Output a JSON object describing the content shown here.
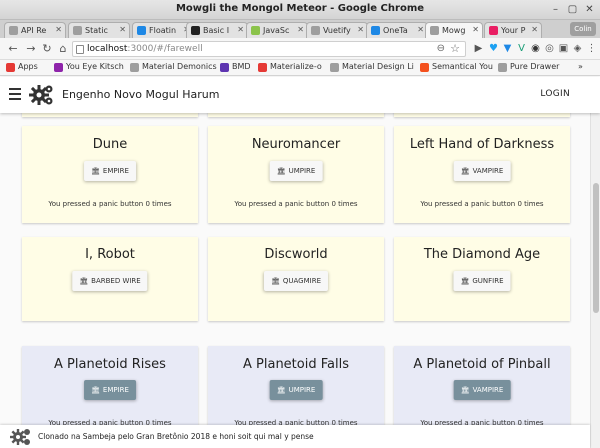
{
  "window": {
    "title": "Mowgli the Mongol Meteor - Google Chrome"
  },
  "tabs": [
    {
      "label": "API Re",
      "fav_color": "#9e9e9e"
    },
    {
      "label": "Static",
      "fav_color": "#9e9e9e"
    },
    {
      "label": "Floatin",
      "fav_color": "#1e88e5"
    },
    {
      "label": "Basic I",
      "fav_color": "#222222"
    },
    {
      "label": "JavaSc",
      "fav_color": "#8bc34a"
    },
    {
      "label": "Vuetify",
      "fav_color": "#9e9e9e"
    },
    {
      "label": "OneTa",
      "fav_color": "#1e88e5"
    },
    {
      "label": "Mowg",
      "fav_color": "#9e9e9e"
    },
    {
      "label": "Your P",
      "fav_color": "#e91e63"
    }
  ],
  "profile_label": "Colin",
  "address": {
    "host": "localhost",
    "path": ":3000/#/farewell"
  },
  "bookmarks": [
    {
      "label": "Apps",
      "color": "#e53935"
    },
    {
      "label": "You Eye Kitsch",
      "color": "#8e24aa"
    },
    {
      "label": "Material Demonics",
      "color": "#9e9e9e"
    },
    {
      "label": "BMD",
      "color": "#5e35b1"
    },
    {
      "label": "Materialize-o",
      "color": "#e53935"
    },
    {
      "label": "Material Design Li",
      "color": "#9e9e9e"
    },
    {
      "label": "Semantical You",
      "color": "#f4511e"
    },
    {
      "label": "Pure Drawer",
      "color": "#9e9e9e"
    }
  ],
  "bookmarks_more": "»",
  "app": {
    "title": "Engenho Novo Mogul Harum",
    "login": "LOGIN"
  },
  "cards": [
    {
      "title": "Dune",
      "button": "EMPIRE",
      "text": "You pressed a panic button 0 times",
      "theme": "yellow"
    },
    {
      "title": "Neuromancer",
      "button": "UMPIRE",
      "text": "You pressed a panic button 0 times",
      "theme": "yellow"
    },
    {
      "title": "Left Hand of Darkness",
      "button": "VAMPIRE",
      "text": "You pressed a panic button 0 times",
      "theme": "yellow"
    },
    {
      "title": "I, Robot",
      "button": "BARBED WIRE",
      "text": "",
      "theme": "yellow"
    },
    {
      "title": "Discworld",
      "button": "QUAGMIRE",
      "text": "",
      "theme": "yellow"
    },
    {
      "title": "The Diamond Age",
      "button": "GUNFIRE",
      "text": "",
      "theme": "yellow"
    },
    {
      "title": "A Planetoid Rises",
      "button": "EMPIRE",
      "text": "You pressed a panic button 0 times",
      "theme": "blue"
    },
    {
      "title": "A Planetoid Falls",
      "button": "UMPIRE",
      "text": "You pressed a panic button 0 times",
      "theme": "blue"
    },
    {
      "title": "A Planetoid of Pinball",
      "button": "VAMPIRE",
      "text": "You pressed a panic button 0 times",
      "theme": "blue"
    }
  ],
  "footer": {
    "text": "Clonado na Sambeja pelo Gran Bretônio 2018 e honi soit qui mal y pense"
  }
}
